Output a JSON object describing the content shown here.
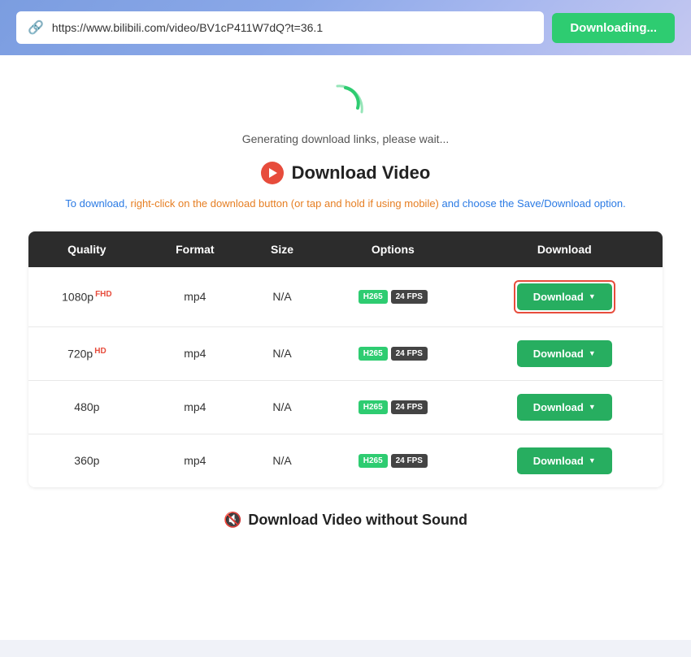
{
  "topbar": {
    "url": "https://www.bilibili.com/video/BV1cP411W7dQ?t=36.1",
    "button_label": "Downloading..."
  },
  "spinner": {
    "text": "Generating download links, please wait..."
  },
  "section_title": "Download Video",
  "info_text_1": "To download, right-click on the download button (or tap and hold if using mobile) and choose the Save/Download option.",
  "table": {
    "headers": [
      "Quality",
      "Format",
      "Size",
      "Options",
      "Download"
    ],
    "rows": [
      {
        "quality": "1080p",
        "quality_badge": "FHD",
        "quality_badge_type": "fhd",
        "format": "mp4",
        "size": "N/A",
        "options_codec": "H265",
        "options_fps": "24 FPS",
        "download_label": "Download",
        "highlighted": true
      },
      {
        "quality": "720p",
        "quality_badge": "HD",
        "quality_badge_type": "hd",
        "format": "mp4",
        "size": "N/A",
        "options_codec": "H265",
        "options_fps": "24 FPS",
        "download_label": "Download",
        "highlighted": false
      },
      {
        "quality": "480p",
        "quality_badge": "",
        "quality_badge_type": "",
        "format": "mp4",
        "size": "N/A",
        "options_codec": "H265",
        "options_fps": "24 FPS",
        "download_label": "Download",
        "highlighted": false
      },
      {
        "quality": "360p",
        "quality_badge": "",
        "quality_badge_type": "",
        "format": "mp4",
        "size": "N/A",
        "options_codec": "H265",
        "options_fps": "24 FPS",
        "download_label": "Download",
        "highlighted": false
      }
    ]
  },
  "no_sound_section": {
    "title": "Download Video without Sound"
  },
  "colors": {
    "green": "#27ae60",
    "red": "#e74c3c",
    "blue": "#2a7ae4"
  }
}
